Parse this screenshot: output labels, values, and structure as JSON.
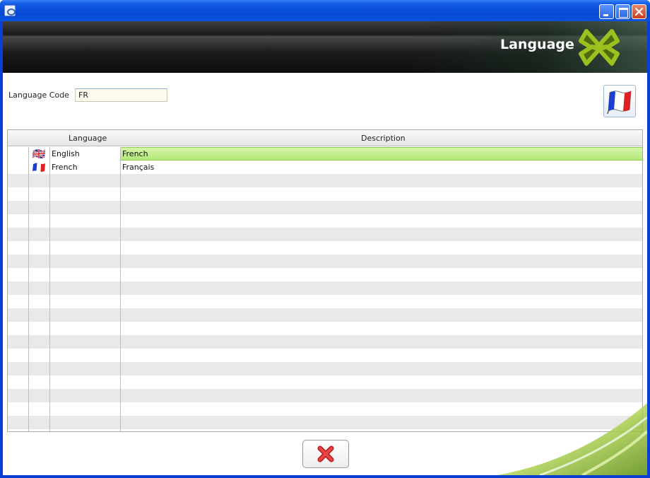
{
  "window": {
    "title": "",
    "icons": {
      "app": "app-icon",
      "minimize": "minimize-icon",
      "maximize": "maximize-icon",
      "close": "close-icon"
    }
  },
  "header": {
    "title": "Language",
    "logo": "clover-logo"
  },
  "form": {
    "language_code_label": "Language Code",
    "language_code_value": "FR",
    "flag_button_icon": "french-flag-icon"
  },
  "grid": {
    "columns": [
      "Language",
      "Description"
    ],
    "rows": [
      {
        "flag": "uk-flag-icon",
        "language": "English",
        "description": "French",
        "selected": true
      },
      {
        "flag": "french-flag-icon",
        "language": "French",
        "description": "Français",
        "selected": false
      }
    ],
    "empty_rows": 19
  },
  "footer": {
    "close_button_icon": "red-x-icon"
  },
  "colors": {
    "selection_green": "#b3e77a",
    "titlebar_blue": "#0a4fdb",
    "logo_green": "#8cb21e"
  }
}
